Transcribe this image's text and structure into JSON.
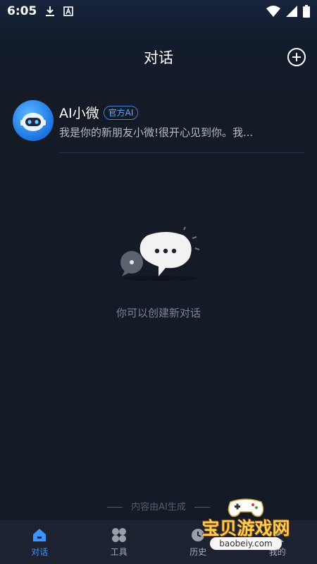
{
  "status_bar": {
    "time": "6:05",
    "icons": [
      "download-icon",
      "app-notification-icon",
      "wifi-icon",
      "signal-icon",
      "battery-icon"
    ]
  },
  "header": {
    "title": "对话",
    "new_chat_icon": "plus-circle-icon"
  },
  "conversation": {
    "name": "AI小微",
    "badge": "官方AI",
    "preview": "我是你的新朋友小微!很开心见到你。我..."
  },
  "empty_state": {
    "text": "你可以创建新对话"
  },
  "footer_note": "内容由AI生成",
  "nav": {
    "items": [
      {
        "label": "对话",
        "icon": "home-icon",
        "active": true
      },
      {
        "label": "工具",
        "icon": "grid-icon",
        "active": false
      },
      {
        "label": "历史",
        "icon": "history-icon",
        "active": false
      },
      {
        "label": "我的",
        "icon": "profile-icon",
        "active": false
      }
    ]
  },
  "watermark": {
    "text": "宝贝游戏网",
    "url": "baobeiy.com"
  },
  "colors": {
    "accent": "#3f93ff",
    "background": "#141a26",
    "badge": "#5fa9ff"
  }
}
